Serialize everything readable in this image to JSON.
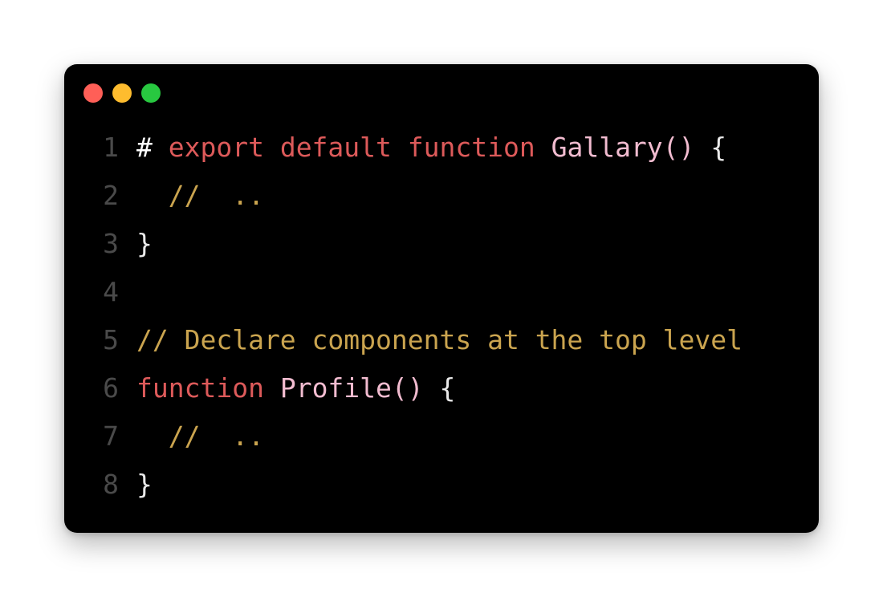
{
  "colors": {
    "background": "#000000",
    "keyword": "#dd5a5a",
    "function_name": "#f2bcd0",
    "punctuation": "#e9e9e9",
    "comment": "#caa44f",
    "line_number": "#4a4a4a",
    "close_dot": "#ff5f57",
    "minimize_dot": "#febc2e",
    "maximize_dot": "#28c840"
  },
  "code": {
    "lines": [
      {
        "number": "1",
        "tokens": [
          {
            "text": "# ",
            "type": "plain"
          },
          {
            "text": "export default function",
            "type": "kw"
          },
          {
            "text": " ",
            "type": "plain"
          },
          {
            "text": "Gallary",
            "type": "fn"
          },
          {
            "text": "()",
            "type": "fn"
          },
          {
            "text": " {",
            "type": "punct"
          }
        ]
      },
      {
        "number": "2",
        "tokens": [
          {
            "text": "  ",
            "type": "plain"
          },
          {
            "text": "//  ..",
            "type": "comment"
          }
        ]
      },
      {
        "number": "3",
        "tokens": [
          {
            "text": "}",
            "type": "punct"
          }
        ]
      },
      {
        "number": "4",
        "tokens": []
      },
      {
        "number": "5",
        "tokens": [
          {
            "text": "// Declare components at the top level",
            "type": "comment"
          }
        ]
      },
      {
        "number": "6",
        "tokens": [
          {
            "text": "function",
            "type": "kw"
          },
          {
            "text": " ",
            "type": "plain"
          },
          {
            "text": "Profile",
            "type": "fn"
          },
          {
            "text": "()",
            "type": "fn"
          },
          {
            "text": " {",
            "type": "punct"
          }
        ]
      },
      {
        "number": "7",
        "tokens": [
          {
            "text": "  ",
            "type": "plain"
          },
          {
            "text": "//  ..",
            "type": "comment"
          }
        ]
      },
      {
        "number": "8",
        "tokens": [
          {
            "text": "}",
            "type": "punct"
          }
        ]
      }
    ]
  }
}
